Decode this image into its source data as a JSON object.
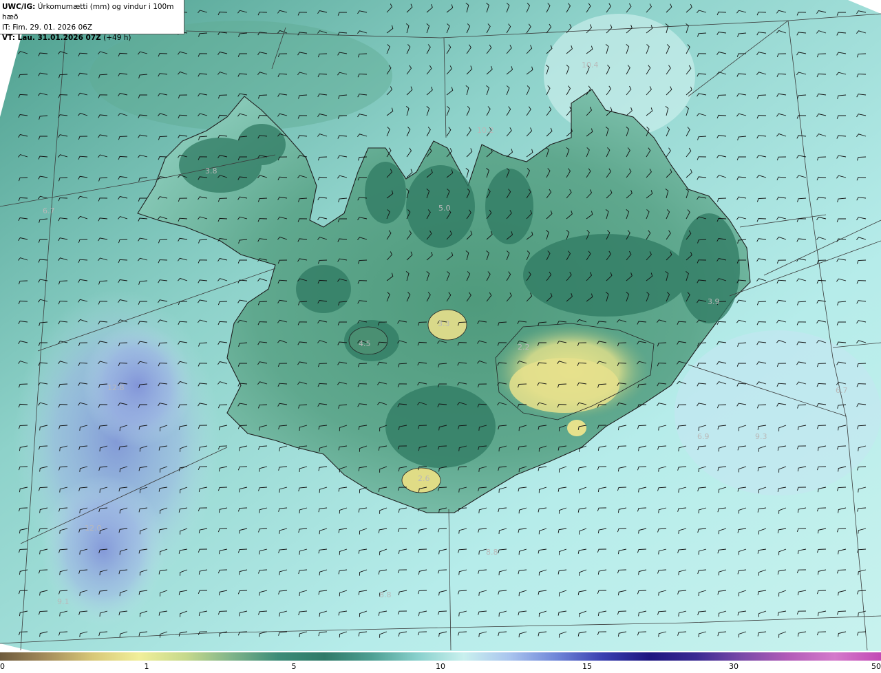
{
  "header": {
    "source_label": "UWC/IG:",
    "title": "Úrkomumætti (mm) og vindur i 100m hæð",
    "it_line": "IT: Fim. 29. 01. 2026 06Z",
    "vt_label": "VT: Lau. 31.01.2026 07Z",
    "vt_lead": "(+49 h)"
  },
  "map_labels": [
    "10.4",
    "10.2",
    "3.8",
    "6.7",
    "5.0",
    "3.3",
    "4.5",
    "2.2",
    "3.9",
    "12.8",
    "6.9",
    "9.3",
    "12.0",
    "9.1",
    "2.6",
    "8.8",
    "8.8",
    "6.7"
  ],
  "colorbar": {
    "ticks": [
      "0",
      "1",
      "5",
      "10",
      "15",
      "30",
      "50"
    ],
    "colors": [
      "#6e5a3c",
      "#a58d5c",
      "#d8c878",
      "#f1ef9a",
      "#c6d98c",
      "#7fb48a",
      "#3d8c78",
      "#2f7a68",
      "#4d9f92",
      "#88d0cc",
      "#c9f0ee",
      "#a9c4ee",
      "#6f86d8",
      "#3a3fb0",
      "#1d1580",
      "#3a2a92",
      "#7a4aa8",
      "#b25cb8",
      "#d47acb",
      "#c24ab5"
    ]
  },
  "colors": {
    "land_dark": "#2f7a62",
    "land_light": "#e2e28a",
    "ocean": "#a8e0da",
    "ocean_precip": "#8f9fdc"
  }
}
